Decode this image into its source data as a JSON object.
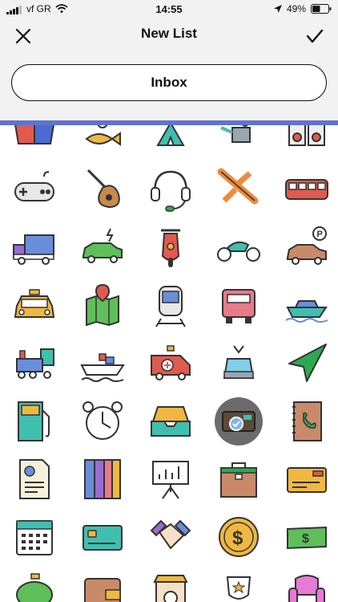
{
  "status": {
    "carrier": "vf GR",
    "time": "14:55",
    "battery": "49%"
  },
  "nav": {
    "title": "New List"
  },
  "list_name": {
    "value": "Inbox"
  },
  "icons": [
    [
      "bowl-icon",
      "fish-icon",
      "tent-icon",
      "watering-can-icon",
      "speakers-icon"
    ],
    [
      "gamepad-icon",
      "guitar-icon",
      "headset-icon",
      "airplane-icon",
      "bus-icon"
    ],
    [
      "truck-icon",
      "electric-car-icon",
      "scooter-icon",
      "motorcycle-icon",
      "parking-car-icon"
    ],
    [
      "taxi-icon",
      "map-icon",
      "train-icon",
      "lorry-icon",
      "boat-icon"
    ],
    [
      "steam-train-icon",
      "cargo-ship-icon",
      "ambulance-icon",
      "cable-car-icon",
      "navigation-arrow-icon"
    ],
    [
      "fuel-pump-icon",
      "alarm-clock-icon",
      "inbox-tray-icon",
      "id-card-icon",
      "phone-book-icon"
    ],
    [
      "document-chart-icon",
      "binders-icon",
      "presentation-board-icon",
      "briefcase-icon",
      "credit-card-icon"
    ],
    [
      "calendar-icon",
      "bank-card-icon",
      "handshake-icon",
      "dollar-coin-icon",
      "banknote-icon"
    ],
    [
      "piggy-bank-icon",
      "wallet-icon",
      "safe-icon",
      "trophy-icon",
      "armchair-icon"
    ]
  ],
  "selected_icon": "id-card-icon",
  "colors": {
    "header_bg": "#f2f2f2",
    "accent_blue": "#5f74cf",
    "selected_ring": "#6b6b6b"
  }
}
